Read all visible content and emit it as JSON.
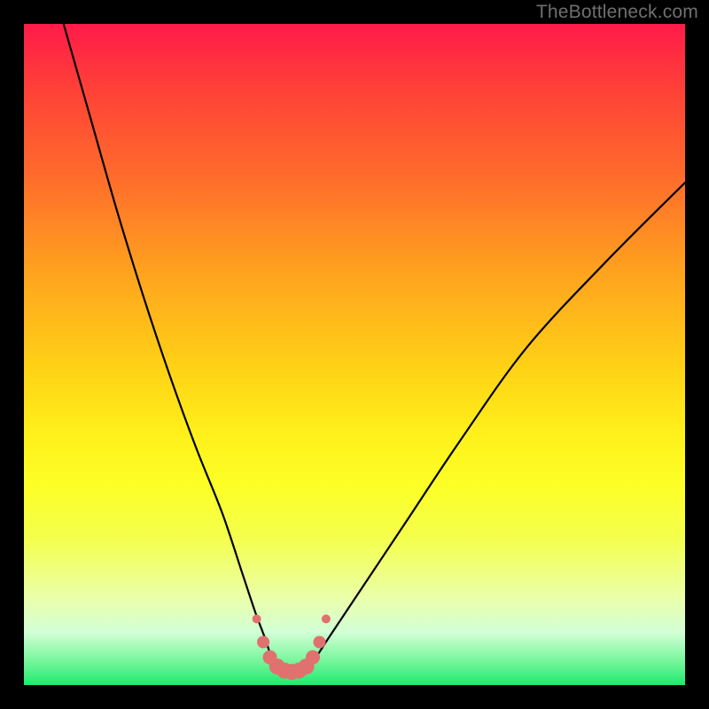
{
  "watermark": "TheBottleneck.com",
  "chart_data": {
    "type": "line",
    "title": "",
    "xlabel": "",
    "ylabel": "",
    "xlim": [
      0,
      100
    ],
    "ylim": [
      0,
      100
    ],
    "series": [
      {
        "name": "bottleneck-curve",
        "x": [
          6,
          10,
          14,
          18,
          22,
          26,
          30,
          33,
          35,
          36.5,
          37.5,
          38.5,
          39.5,
          41,
          42.5,
          44,
          46,
          48,
          52,
          58,
          66,
          76,
          88,
          100
        ],
        "y": [
          100,
          86,
          72,
          59,
          47,
          36,
          26,
          17,
          11,
          7,
          4,
          2.5,
          2,
          2,
          2.5,
          4,
          7,
          10,
          16,
          25,
          37,
          51,
          64,
          76
        ]
      }
    ],
    "markers": {
      "name": "highlight-points",
      "color": "#e0716e",
      "x": [
        35.2,
        36.2,
        37.2,
        38.3,
        39.4,
        40.5,
        41.6,
        42.7,
        43.7,
        44.7,
        45.7
      ],
      "y": [
        10.0,
        6.5,
        4.2,
        2.8,
        2.2,
        2.0,
        2.2,
        2.8,
        4.2,
        6.5,
        10.0
      ],
      "radius": [
        5,
        7,
        8,
        9,
        9,
        9,
        9,
        9,
        8,
        7,
        5
      ]
    },
    "background_gradient": {
      "top": "#ff1b49",
      "mid": "#fff01a",
      "bottom": "#1eea6f"
    }
  }
}
